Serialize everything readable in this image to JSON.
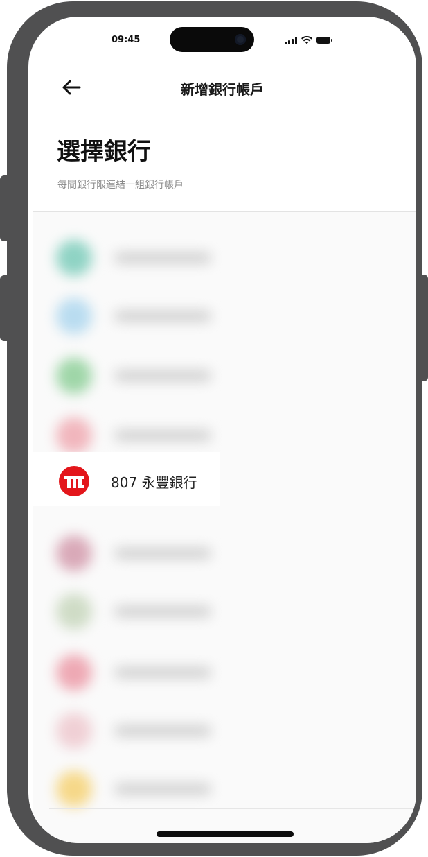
{
  "status_bar": {
    "time": "09:45"
  },
  "header": {
    "title": "新增銀行帳戶",
    "back_icon": "arrow-left-icon"
  },
  "page": {
    "title": "選擇銀行",
    "subtitle": "每間銀行限連結一組銀行帳戶"
  },
  "bank_list": {
    "blurred_rows": [
      {
        "logo_color": "#8fd3c4"
      },
      {
        "logo_color": "#b9dcf0"
      },
      {
        "logo_color": "#9fd6a8"
      },
      {
        "logo_color": "#f1b6bd"
      },
      {
        "logo_color": "#d9a9b8"
      },
      {
        "logo_color": "#cfdcc6"
      },
      {
        "logo_color": "#eea9b4"
      },
      {
        "logo_color": "#f0d0d5"
      },
      {
        "logo_color": "#f6d889"
      }
    ],
    "selected": {
      "name": "807 永豐銀行",
      "logo_color": "#e3161b"
    }
  },
  "colors": {
    "frame": "#505051",
    "accent_red": "#e3161b"
  }
}
